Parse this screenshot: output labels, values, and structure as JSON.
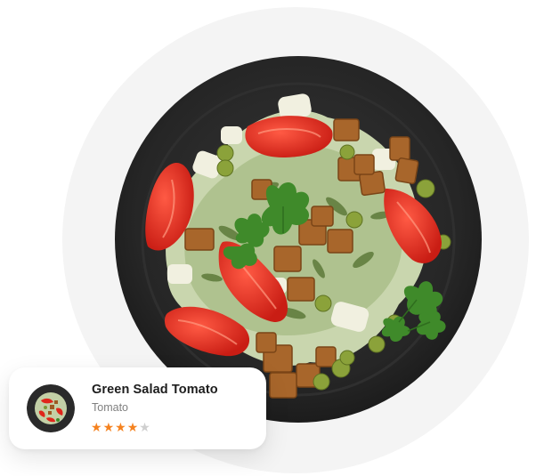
{
  "card": {
    "title": "Green Salad Tomato",
    "subtitle": "Tomato",
    "rating": 4,
    "rating_max": 5
  },
  "colors": {
    "star_filled": "#f5821f",
    "star_empty": "#cfcfcf",
    "plate": "#262626",
    "tomato": "#e12a1f"
  },
  "icons": {
    "star": "star-icon"
  }
}
